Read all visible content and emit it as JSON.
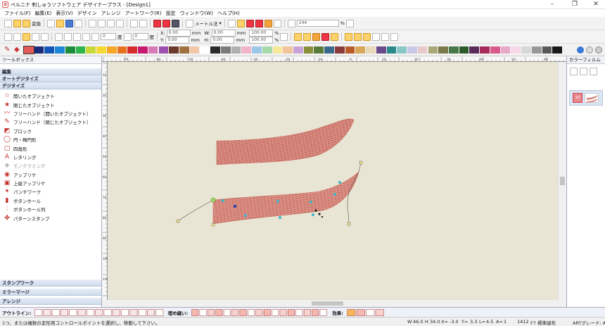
{
  "window": {
    "title": "ベルニナ 刺しゅうソフトウェア デザイナープラス - [Design1]"
  },
  "menu": [
    "ファイル(F)",
    "編集(E)",
    "表示(V)",
    "デザイン",
    "アレンジ",
    "アートワーク(R)",
    "設定",
    "ウィンドウ(W)",
    "ヘルプ(H)"
  ],
  "toolbar1": {
    "convert_label": "変換",
    "units_label": "メートル法",
    "zoom_value": "244",
    "zoom_percent": "%"
  },
  "toolbar2": {
    "x_label": "X:",
    "x_value": "0.00",
    "y_label": "Y:",
    "y_value": "0.00",
    "w_label": "W:",
    "w_value": "0.00",
    "h_label": "H:",
    "h_value": "0.00",
    "mm": "mm",
    "pw_value": "100.00",
    "ph_value": "100.00",
    "pct": "%",
    "rot_value": "0",
    "deg": "度",
    "slant_value": "0"
  },
  "palette": {
    "colors": [
      "#e35c5a",
      "#1a2a7a",
      "#1456b8",
      "#1c86d8",
      "#1a8c3a",
      "#2db34a",
      "#c8d838",
      "#f6d832",
      "#f5a623",
      "#e8711d",
      "#d42b2b",
      "#c8196e",
      "#d87ab8",
      "#9b4fb0",
      "#6b3a2a",
      "#a0703e",
      "#f4c7a8",
      "#ffffff",
      "#2a2a2a",
      "#7a7a7a",
      "#b0b0b0",
      "#f0b6c8",
      "#9bc7e8",
      "#a6d8a8",
      "#f8e89a",
      "#f2c49b",
      "#c9a3d6",
      "#8a8f3a",
      "#5a7a3a",
      "#3a6a8a",
      "#8a3a3a",
      "#b85a2a",
      "#d8a85a",
      "#e8d8b8",
      "#6a4a8a",
      "#2a8a8a",
      "#8ac8c8",
      "#c8c8e8",
      "#e8c8c8",
      "#a8a878",
      "#787848",
      "#487848",
      "#2a5a2a",
      "#5a2a5a",
      "#a82a5a",
      "#d85a8a",
      "#e8a8c8",
      "#f8d8e8",
      "#d8d8d8",
      "#989898",
      "#585858",
      "#181818"
    ]
  },
  "toolbox": {
    "title": "ツールボックス",
    "categories": {
      "edit": "編集",
      "autodigitize": "オートデジタイズ",
      "digitize": "デジタイズ",
      "stampwork": "スタンプワーク",
      "mirror_merge": "ミラーマージ",
      "arrange": "アレンジ"
    },
    "tools": [
      {
        "label": "開いたオブジェクト",
        "icon": "☆",
        "disabled": false
      },
      {
        "label": "閉じたオブジェクト",
        "icon": "★",
        "disabled": false
      },
      {
        "label": "フリーハンド（開いたオブジェクト）",
        "icon": "〰",
        "disabled": false
      },
      {
        "label": "フリーハンド（閉じたオブジェクト）",
        "icon": "✎",
        "disabled": false
      },
      {
        "label": "ブロック",
        "icon": "◩",
        "disabled": false
      },
      {
        "label": "円・楕円形",
        "icon": "◯",
        "disabled": false
      },
      {
        "label": "四角形",
        "icon": "▢",
        "disabled": false
      },
      {
        "label": "レタリング",
        "icon": "A",
        "disabled": false
      },
      {
        "label": "モノグラミング",
        "icon": "◈",
        "disabled": true
      },
      {
        "label": "アップリケ",
        "icon": "◉",
        "disabled": false
      },
      {
        "label": "上級アップリケ",
        "icon": "▣",
        "disabled": false
      },
      {
        "label": "パンチワーク",
        "icon": "✦",
        "disabled": false
      },
      {
        "label": "ボタンホール",
        "icon": "▮",
        "disabled": false
      },
      {
        "label": "ボタンホール列",
        "icon": "⦙",
        "disabled": false
      },
      {
        "label": "パターンスタンプ",
        "icon": "✤",
        "disabled": false
      }
    ]
  },
  "ruler": {
    "h_ticks": [
      "-70",
      "-60",
      "-50",
      "-40",
      "-30",
      "-20",
      "-10",
      "0",
      "10",
      "20",
      "30",
      "40",
      "50",
      "60"
    ],
    "v_ticks": [
      "10",
      "20",
      "30",
      "40",
      "50",
      "60",
      "70",
      "80",
      "90",
      "100",
      "110"
    ]
  },
  "colorfilm": {
    "title": "カラーフィルム",
    "item_number": "10"
  },
  "bottombar": {
    "outline_label": "アウトライン:",
    "fill_label": "埋め縫い:",
    "effect_label": "効果:"
  },
  "status": {
    "hint": "1つ、または複数の変形用コントロールポイントを選択し、移動して下さい。",
    "w": "W",
    "w_value": "46.0",
    "h": "H",
    "h_value": "34.0",
    "x": "X=",
    "x_value": "-3.0",
    "y": "Y=",
    "y_value": "3.3",
    "l": "L=",
    "l_value": "4.5",
    "a": "A=",
    "a_value": "1",
    "stitches": "1412",
    "hoop": "F7 標準縫布",
    "grade": "ARTグレード: A"
  }
}
